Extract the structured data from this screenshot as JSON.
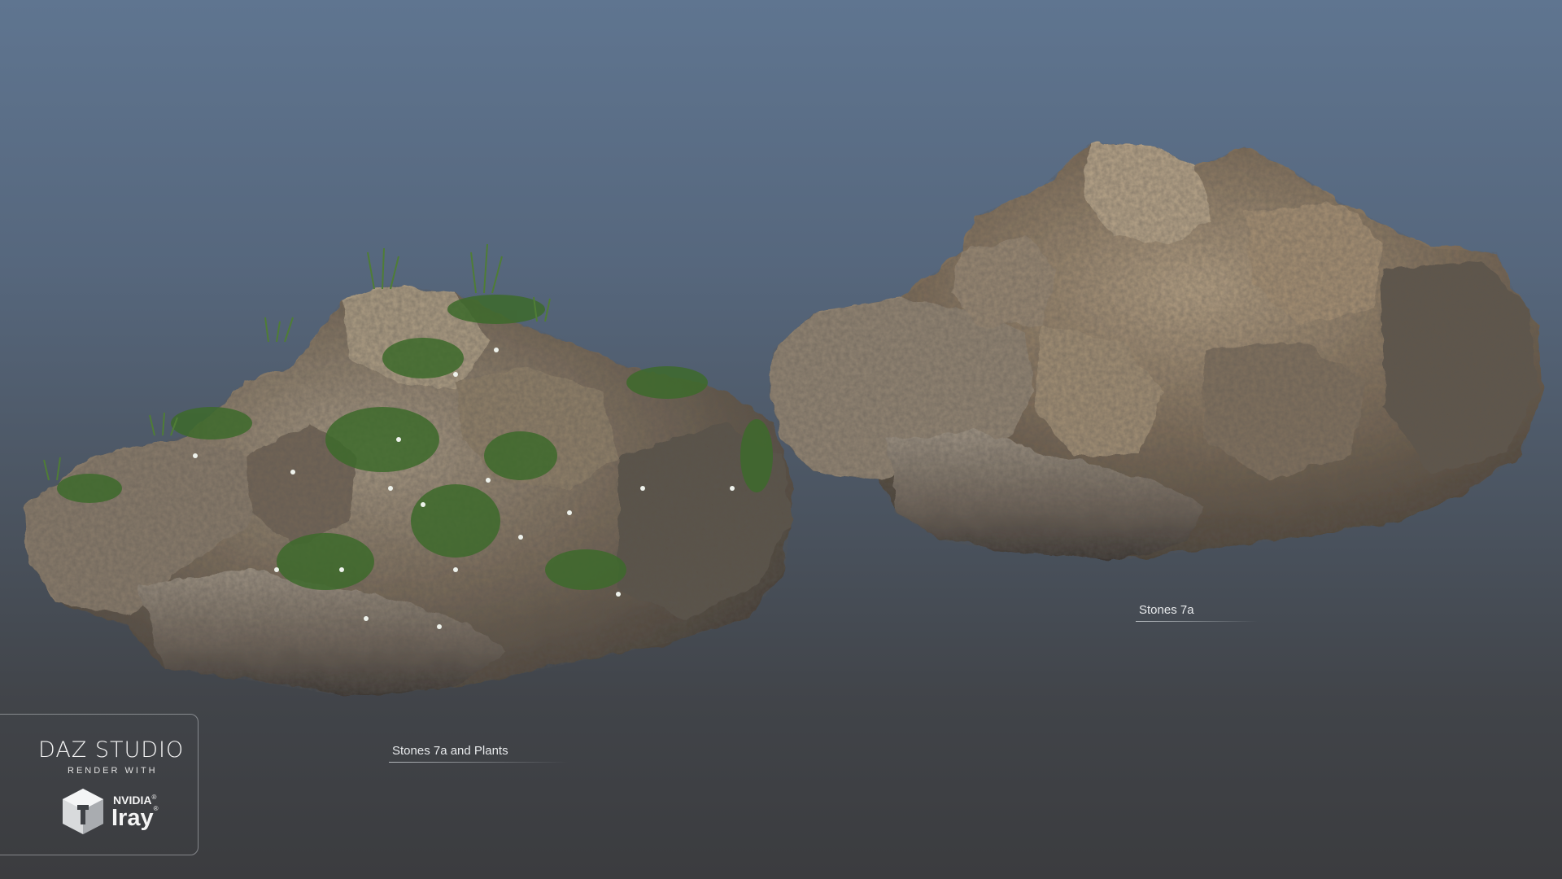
{
  "captions": {
    "left": "Stones 7a and Plants",
    "right": "Stones 7a"
  },
  "badge": {
    "title": "DAZ STUDIO",
    "subtitle": "RENDER WITH",
    "brand": "NVIDIA",
    "product": "Iray",
    "registered": "®"
  },
  "colors": {
    "background_top": "#5f7590",
    "background_bottom": "#3b3c3f",
    "rock_base": "#6d6253",
    "rock_light": "#a89a86",
    "rock_shadow": "#3a352f",
    "foliage": "#3f6b2c",
    "flowers": "#f0f3ee"
  }
}
